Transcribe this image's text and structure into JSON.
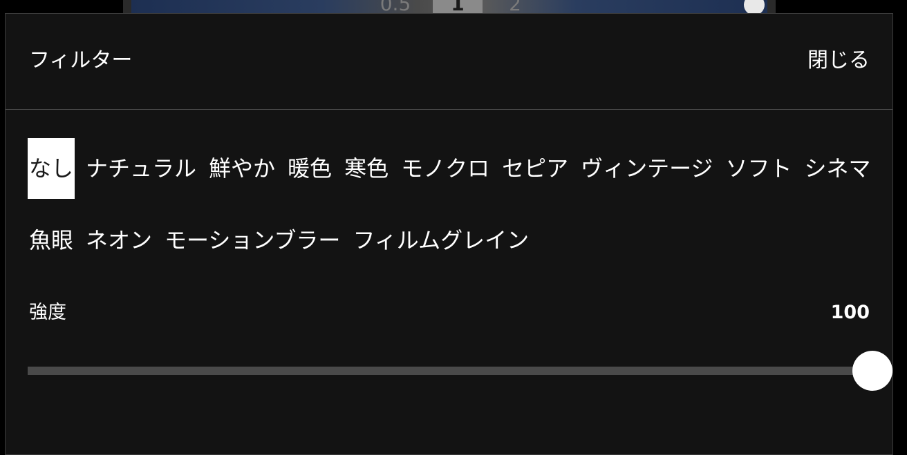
{
  "video": {
    "speeds": [
      {
        "label": "0.5",
        "selected": false
      },
      {
        "label": "1",
        "selected": true
      },
      {
        "label": "2",
        "selected": false
      }
    ]
  },
  "panel": {
    "title": "フィルター",
    "close_label": "閉じる"
  },
  "filters": {
    "selected": "なし",
    "row1": [
      "なし",
      "ナチュラル",
      "鮮やか",
      "暖色",
      "寒色",
      "モノクロ",
      "セピア",
      "ヴィンテージ",
      "ソフト",
      "シネマ"
    ],
    "row2": [
      "魚眼",
      "ネオン",
      "モーションブラー",
      "フィルムグレイン"
    ]
  },
  "strength": {
    "label": "強度",
    "value": "100",
    "fraction": 1.0
  },
  "colors": {
    "panel_bg": "#131313",
    "selected_chip_bg": "#ffffff",
    "track": "#4a4a4a",
    "thumb": "#ffffff"
  }
}
